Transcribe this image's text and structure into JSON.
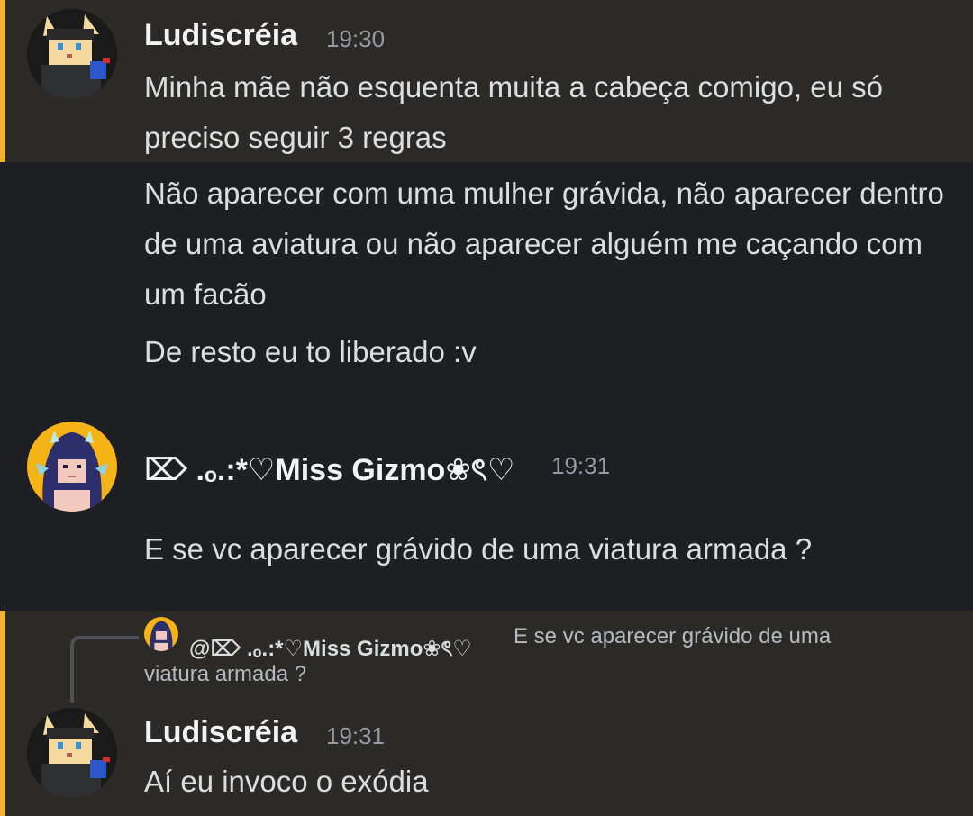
{
  "colors": {
    "background": "#1e1f22",
    "highlight_background": "#2b2a27",
    "mention_bar": "#f0b232",
    "timestamp": "#949ba4"
  },
  "messages": [
    {
      "author": "Ludiscréia",
      "time": "19:30",
      "avatar": "ludiscreia-pixel-cat-avatar",
      "lines": [
        "Minha mãe não esquenta muita a cabeça comigo, eu só preciso seguir 3 regras",
        "Não aparecer com uma mulher grávida, não aparecer dentro de uma aviatura ou não aparecer alguém me caçando com um facão",
        "De resto eu to liberado :v"
      ]
    },
    {
      "author": "⌦ .ₒ.:*♡Miss Gizmo❀ৎ♡",
      "time": "19:31",
      "avatar": "miss-gizmo-anime-avatar",
      "lines": [
        "E se vc aparecer grávido de uma viatura armada ?"
      ]
    },
    {
      "author": "Ludiscréia",
      "time": "19:31",
      "avatar": "ludiscreia-pixel-cat-avatar",
      "reply": {
        "author": "@⌦ .ₒ.:*♡Miss Gizmo❀ৎ♡",
        "text_line1": "E se vc aparecer grávido de uma",
        "text_line2": "viatura armada ?"
      },
      "lines": [
        "Aí eu invoco o exódia"
      ]
    }
  ]
}
